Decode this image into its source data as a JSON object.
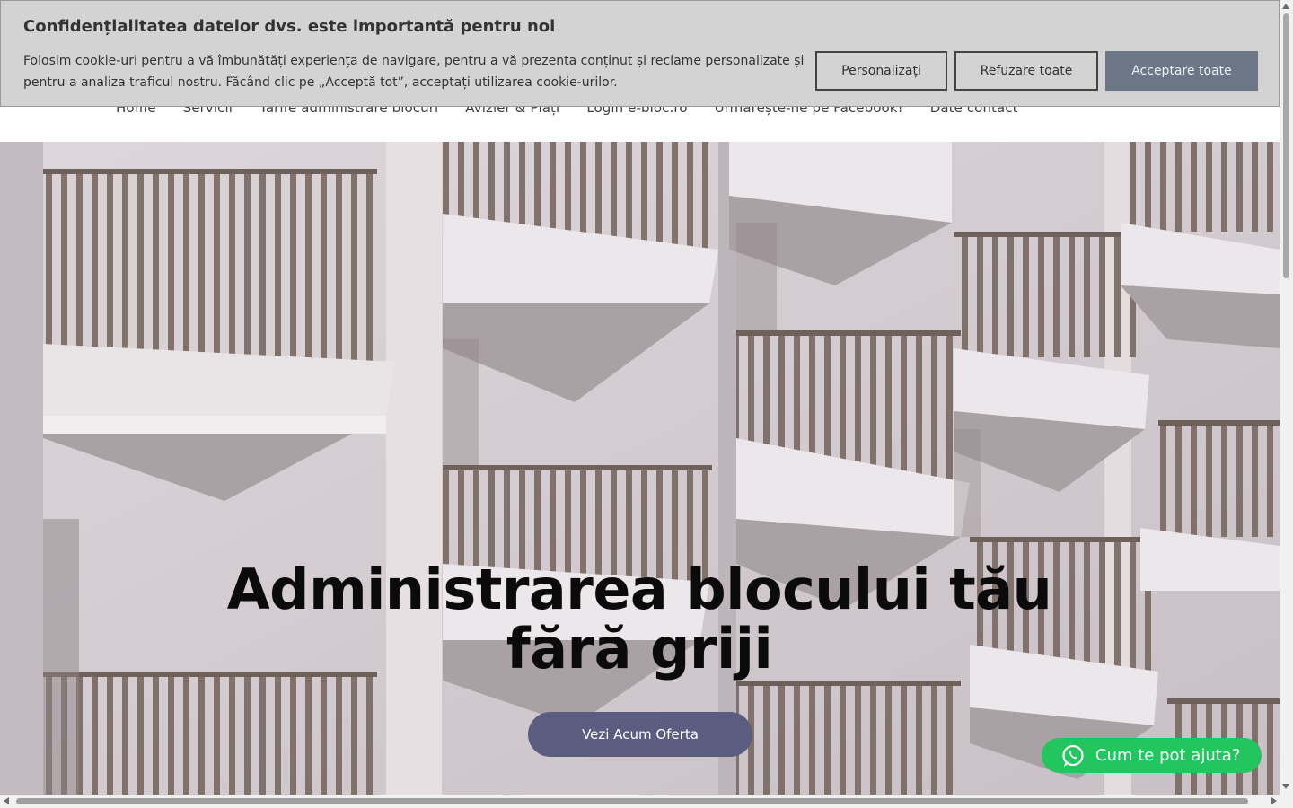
{
  "nav": {
    "items": [
      {
        "label": "Home"
      },
      {
        "label": "Servicii"
      },
      {
        "label": "Tarife administrare blocuri"
      },
      {
        "label": "Avizier & Plăți"
      },
      {
        "label": "Login e-bloc.ro"
      },
      {
        "label": "Urmărește-ne pe Facebook!"
      },
      {
        "label": "Date contact"
      }
    ]
  },
  "hero": {
    "title": "Administrarea blocului tău fără griji",
    "cta_label": "Vezi Acum Oferta"
  },
  "cookie_banner": {
    "title": "Confidențialitatea datelor dvs. este importantă pentru noi",
    "text": "Folosim cookie-uri pentru a vă îmbunătăți experiența de navigare, pentru a vă prezenta conținut și reclame personalizate și pentru a analiza traficul nostru. Făcând clic pe „Acceptă tot”, acceptați utilizarea cookie-urilor.",
    "customize_label": "Personalizați",
    "reject_label": "Refuzare toate",
    "accept_label": "Acceptare toate"
  },
  "whatsapp": {
    "label": "Cum te pot ajuta?",
    "icon": "whatsapp-icon"
  },
  "colors": {
    "cta_background": "#5a5c80",
    "accept_button": "#6b7687",
    "whatsapp_green": "#22c55e",
    "banner_background": "#d3d3d3"
  }
}
